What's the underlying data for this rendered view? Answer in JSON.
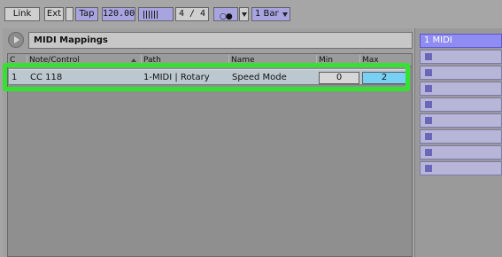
{
  "transport": {
    "link_label": "Link",
    "ext_label": "Ext",
    "tap_label": "Tap",
    "tempo": "120.00",
    "time_signature": "4  /  4",
    "quantization": "1 Bar"
  },
  "midi_mappings": {
    "title": "MIDI Mappings",
    "columns": {
      "channel": "C",
      "note_control": "Note/Control",
      "path": "Path",
      "name": "Name",
      "min": "Min",
      "max": "Max"
    },
    "rows": [
      {
        "channel": "1",
        "note_control": "CC 118",
        "path": "1-MIDI | Rotary",
        "name": "Speed Mode",
        "min": "0",
        "max": "2"
      }
    ]
  },
  "tracks": {
    "active_track_label": "1 MIDI",
    "clip_slot_count": 8
  },
  "colors": {
    "highlight": "#35e233",
    "max_field": "#79d0f5",
    "track_active": "#8f8cf3",
    "row_background": "#bcc8cf"
  }
}
